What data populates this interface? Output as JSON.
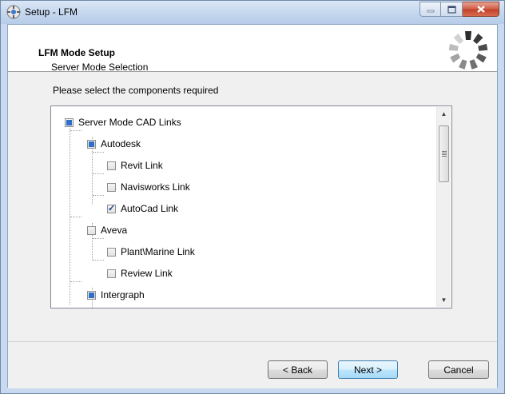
{
  "window": {
    "title": "Setup - LFM",
    "icon": "setup-icon"
  },
  "header": {
    "title": "LFM Mode Setup",
    "subtitle": "Server Mode Selection"
  },
  "prompt": "Please select the components required",
  "tree": {
    "items": [
      {
        "label": "Server Mode CAD Links",
        "state": "partial",
        "level": 0
      },
      {
        "label": "Autodesk",
        "state": "partial",
        "level": 1
      },
      {
        "label": "Revit Link",
        "state": "unchecked",
        "level": 2
      },
      {
        "label": "Navisworks Link",
        "state": "unchecked",
        "level": 2
      },
      {
        "label": "AutoCad Link",
        "state": "checked",
        "level": 2
      },
      {
        "label": "Aveva",
        "state": "unchecked",
        "level": 1
      },
      {
        "label": "Plant\\Marine Link",
        "state": "unchecked",
        "level": 2
      },
      {
        "label": "Review Link",
        "state": "unchecked",
        "level": 2
      },
      {
        "label": "Intergraph",
        "state": "partial",
        "level": 1
      }
    ]
  },
  "buttons": {
    "back": "< Back",
    "next": "Next >",
    "cancel": "Cancel"
  }
}
